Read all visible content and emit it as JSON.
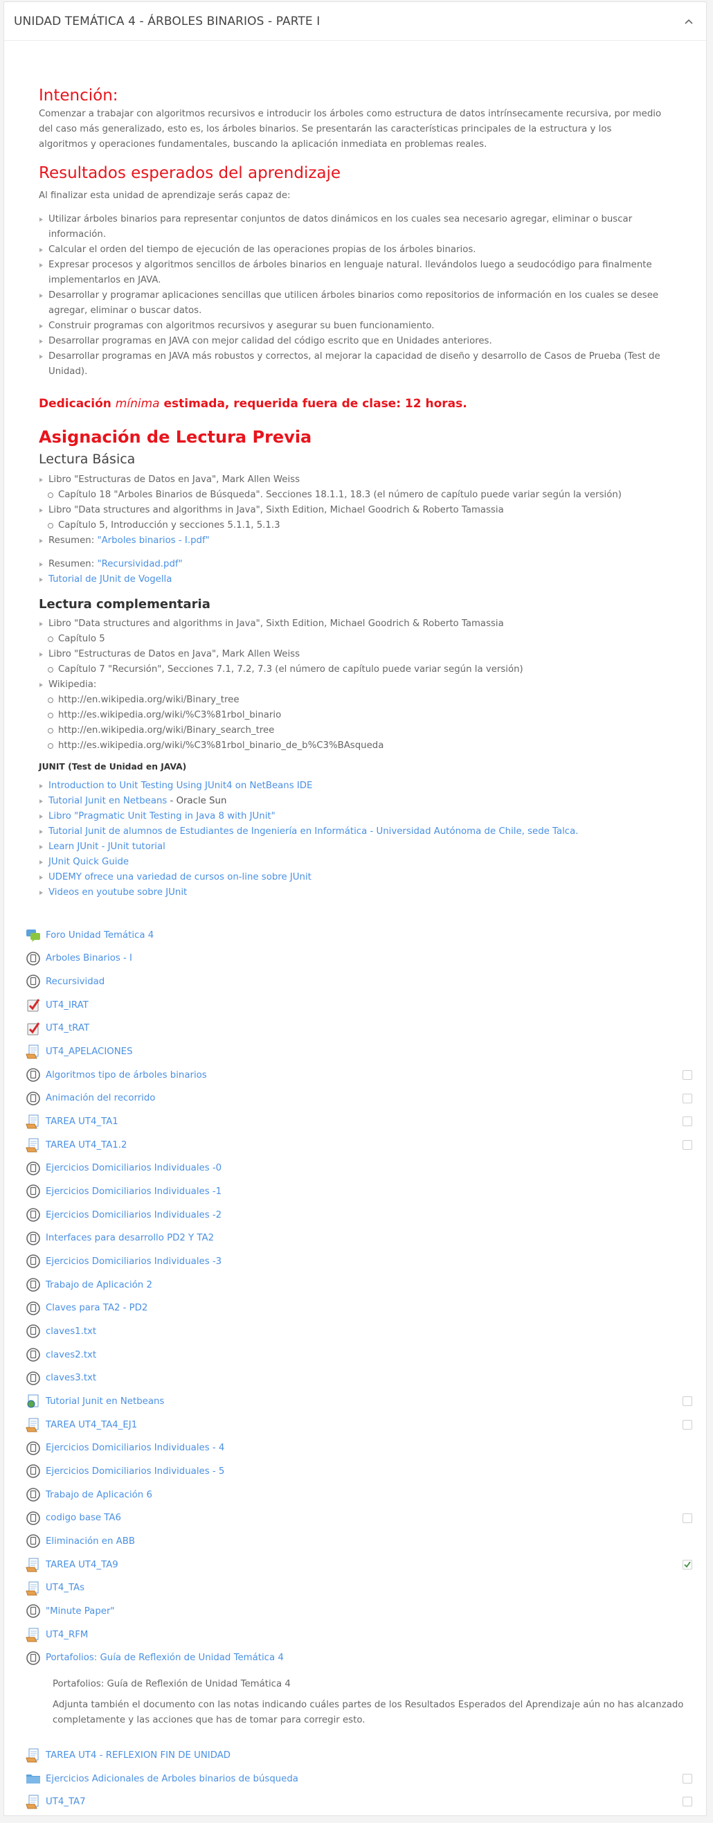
{
  "section": {
    "title": "UNIDAD TEMÁTICA 4 - ÁRBOLES BINARIOS - PARTE I"
  },
  "intencion": {
    "heading": "Intención:",
    "text": "Comenzar a trabajar con algoritmos recursivos e introducir los árboles como estructura de datos intrínsecamente recursiva, por medio del caso más generalizado, esto es, los árboles binarios. Se presentarán las características principales de la estructura y los algoritmos y operaciones fundamentales, buscando la aplicación inmediata en problemas reales."
  },
  "resultados": {
    "heading": "Resultados esperados del aprendizaje",
    "intro": "Al finalizar esta unidad de aprendizaje serás capaz de:",
    "items": [
      "Utilizar árboles binarios para representar conjuntos de datos dinámicos en los cuales sea necesario agregar, eliminar o buscar información.",
      "Calcular el orden del tiempo de ejecución de las operaciones propias de los árboles binarios.",
      "Expresar procesos y algoritmos sencillos de árboles binarios en lenguaje natural. llevándolos luego a seudocódigo para finalmente implementarlos en JAVA.",
      "Desarrollar y programar aplicaciones sencillas que utilicen árboles binarios como repositorios de información en los cuales se desee agregar, eliminar o buscar datos.",
      "Construir programas con algoritmos recursivos y asegurar su buen funcionamiento.",
      "Desarrollar programas en JAVA con mejor calidad del código escrito que en Unidades anteriores.",
      "Desarrollar programas en JAVA más robustos y correctos, al mejorar la capacidad de diseño y desarrollo de Casos de Prueba (Test de Unidad)."
    ]
  },
  "dedicacion": {
    "part1": "Dedicación ",
    "part2": "mínima",
    "part3": " estimada, requerida fuera de clase: 12 horas."
  },
  "lectura": {
    "heading": "Asignación de Lectura Previa",
    "basica_heading": "Lectura Básica",
    "basica_book1": "Libro \"Estructuras de Datos en Java\", Mark Allen Weiss",
    "basica_book1_sub": "Capítulo 18 \"Arboles Binarios de Búsqueda\". Secciones 18.1.1, 18.3 (el número de capítulo puede variar según la versión)",
    "basica_book2": "Libro \"Data structures and algorithms in Java\", Sixth Edition, Michael Goodrich & Roberto Tamassia",
    "basica_book2_sub": "Capítulo 5, Introducción y secciones 5.1.1, 5.1.3",
    "resumen_prefix": "Resumen: ",
    "resumen1_link": "\"Arboles binarios - I.pdf\"",
    "resumen2_link": "\"Recursividad.pdf\"",
    "tutorial_junit": "Tutorial de JUnit de Vogella",
    "comp_heading": "Lectura complementaria",
    "comp_book1": "Libro \"Data structures and algorithms in Java\", Sixth Edition, Michael Goodrich & Roberto Tamassia",
    "comp_book1_sub": "Capítulo 5",
    "comp_book2": "Libro \"Estructuras de Datos en Java\", Mark Allen Weiss",
    "comp_book2_sub": "Capítulo 7 \"Recursión\",  Secciones 7.1, 7.2, 7.3 (el número de capítulo puede variar según la versión)",
    "wiki_label": "Wikipedia:",
    "wiki_links": [
      "http://en.wikipedia.org/wiki/Binary_tree",
      "http://es.wikipedia.org/wiki/%C3%81rbol_binario",
      "http://en.wikipedia.org/wiki/Binary_search_tree",
      "http://es.wikipedia.org/wiki/%C3%81rbol_binario_de_b%C3%BAsqueda"
    ],
    "junit_heading": "JUNIT (Test de Unidad en JAVA)",
    "junit_links": [
      {
        "text": "Introduction to Unit Testing Using JUnit4 on NetBeans IDE",
        "suffix": ""
      },
      {
        "text": "Tutorial Junit en Netbeans",
        "suffix": " - Oracle Sun"
      },
      {
        "text": "Libro \"Pragmatic Unit Testing in Java 8 with JUnit\"",
        "suffix": ""
      },
      {
        "text": "Tutorial Junit de alumnos de Estudiantes de Ingeniería en Informática - Universidad Autónoma de Chile, sede Talca.",
        "suffix": ""
      },
      {
        "text": "Learn JUnit - JUnit tutorial",
        "suffix": ""
      },
      {
        "text": "JUnit Quick Guide",
        "suffix": ""
      },
      {
        "text": "UDEMY ofrece una variedad de cursos on-line sobre JUnit",
        "suffix": ""
      },
      {
        "text": "Videos en youtube sobre JUnit",
        "suffix": ""
      }
    ]
  },
  "activities": [
    {
      "label": "Foro Unidad Temática 4",
      "icon": "forum-icon",
      "check": "none"
    },
    {
      "label": "Arboles Binarios - I",
      "icon": "resource-icon",
      "check": "none"
    },
    {
      "label": "Recursividad",
      "icon": "resource-icon",
      "check": "none"
    },
    {
      "label": "UT4_IRAT",
      "icon": "quiz-icon",
      "check": "none"
    },
    {
      "label": "UT4_tRAT",
      "icon": "quiz-icon",
      "check": "none"
    },
    {
      "label": "UT4_APELACIONES",
      "icon": "assignment-icon",
      "check": "none"
    },
    {
      "label": "Algoritmos tipo de árboles binarios",
      "icon": "resource-icon",
      "check": "empty"
    },
    {
      "label": "Animación del recorrido",
      "icon": "resource-icon",
      "check": "empty"
    },
    {
      "label": "TAREA UT4_TA1",
      "icon": "assignment-icon",
      "check": "empty"
    },
    {
      "label": "TAREA UT4_TA1.2",
      "icon": "assignment-icon",
      "check": "empty"
    },
    {
      "label": " Ejercicios Domiciliarios Individuales -0",
      "icon": "resource-icon",
      "check": "none"
    },
    {
      "label": " Ejercicios Domiciliarios Individuales -1",
      "icon": "resource-icon",
      "check": "none"
    },
    {
      "label": " Ejercicios Domiciliarios Individuales -2",
      "icon": "resource-icon",
      "check": "none"
    },
    {
      "label": "Interfaces para desarrollo PD2 Y TA2",
      "icon": "resource-icon",
      "check": "none"
    },
    {
      "label": "Ejercicios Domiciliarios Individuales -3",
      "icon": "resource-icon",
      "check": "none"
    },
    {
      "label": "Trabajo de Aplicación 2",
      "icon": "resource-icon",
      "check": "none"
    },
    {
      "label": "Claves para TA2 - PD2",
      "icon": "resource-icon",
      "check": "none"
    },
    {
      "label": "claves1.txt",
      "icon": "resource-icon",
      "check": "none"
    },
    {
      "label": "claves2.txt",
      "icon": "resource-icon",
      "check": "none"
    },
    {
      "label": "claves3.txt",
      "icon": "resource-icon",
      "check": "none"
    },
    {
      "label": "Tutorial Junit en Netbeans",
      "icon": "url-icon",
      "check": "empty"
    },
    {
      "label": "TAREA UT4_TA4_EJ1",
      "icon": "assignment-icon",
      "check": "empty"
    },
    {
      "label": "Ejercicios Domiciliarios Individuales - 4",
      "icon": "resource-icon",
      "check": "none"
    },
    {
      "label": "Ejercicios Domiciliarios Individuales - 5",
      "icon": "resource-icon",
      "check": "none"
    },
    {
      "label": "Trabajo de Aplicación 6",
      "icon": "resource-icon",
      "check": "none"
    },
    {
      "label": "codigo base TA6",
      "icon": "resource-icon",
      "check": "empty"
    },
    {
      "label": "Eliminación en ABB",
      "icon": "resource-icon",
      "check": "none"
    },
    {
      "label": "TAREA UT4_TA9",
      "icon": "assignment-icon",
      "check": "checked"
    },
    {
      "label": "UT4_TAs",
      "icon": "assignment-icon",
      "check": "none"
    },
    {
      "label": "\"Minute Paper\"",
      "icon": "resource-icon",
      "check": "none"
    },
    {
      "label": "UT4_RFM",
      "icon": "assignment-icon",
      "check": "none"
    },
    {
      "label": "Portafolios: Guía de Reflexión de Unidad Temática 4",
      "icon": "resource-icon",
      "check": "none"
    },
    {
      "label": "TAREA UT4 - REFLEXION FIN DE UNIDAD",
      "icon": "assignment-icon",
      "check": "none"
    },
    {
      "label": "Ejercicios Adicionales de Arboles binarios de búsqueda",
      "icon": "folder-icon",
      "check": "empty"
    },
    {
      "label": "UT4_TA7",
      "icon": "assignment-icon",
      "check": "empty"
    }
  ],
  "portafolio_desc": {
    "title": "Portafolios: Guía de Reflexión de Unidad Temática 4",
    "text": "Adjunta también el documento con las notas indicando cuáles partes de los Resultados Esperados del Aprendizaje aún no has alcanzado completamente y las acciones que has de tomar para corregir esto."
  },
  "colors": {
    "accent_red": "#e8141c",
    "link_blue": "#4a90e2",
    "check_green": "#3f8f3f"
  }
}
